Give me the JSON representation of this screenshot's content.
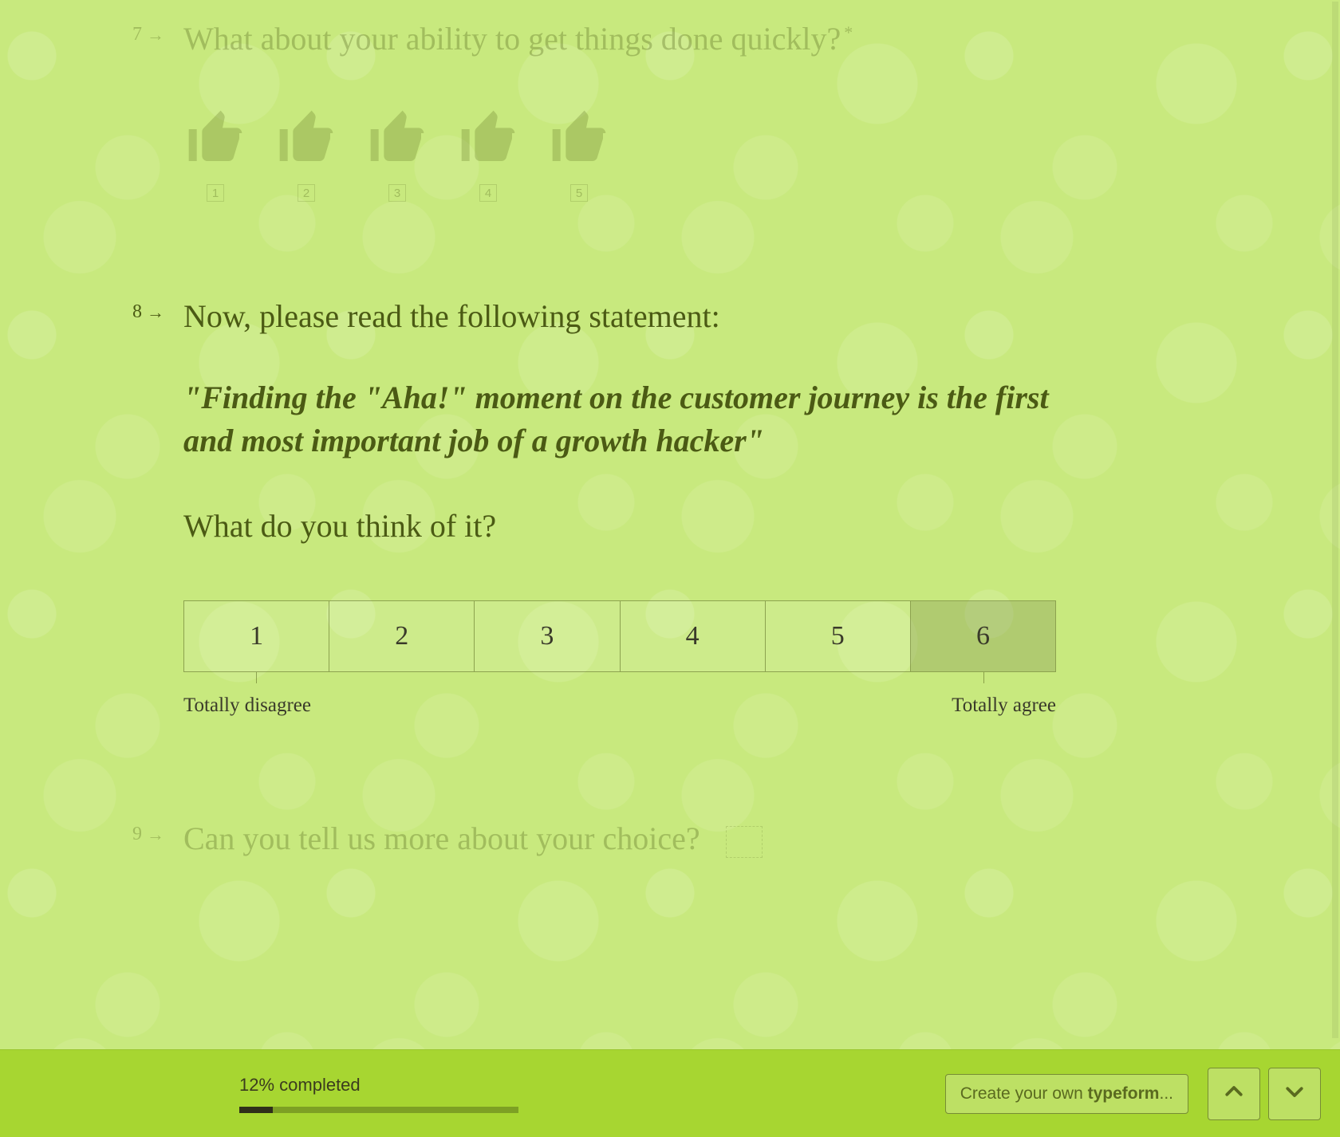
{
  "questions": {
    "q7": {
      "number": "7",
      "text": "What about your ability to get things done quickly?",
      "required_marker": "*",
      "rating": {
        "count": 5,
        "labels": [
          "1",
          "2",
          "3",
          "4",
          "5"
        ],
        "icon": "thumbs-up-icon"
      }
    },
    "q8": {
      "number": "8",
      "intro": "Now, please read the following statement:",
      "statement": "\"Finding the \"Aha!\" moment on the customer journey is the first and most important job of a growth hacker\"",
      "subquestion": "What do you think of it?",
      "scale": {
        "options": [
          "1",
          "2",
          "3",
          "4",
          "5",
          "6"
        ],
        "hover_index": 5,
        "min_label": "Totally disagree",
        "max_label": "Totally agree"
      }
    },
    "q9": {
      "number": "9",
      "text": "Can you tell us more about your choice?"
    }
  },
  "footer": {
    "progress_text": "12% completed",
    "progress_percent": 12,
    "brand_prefix": "Create your own ",
    "brand_bold": "typeform",
    "brand_suffix": "..."
  },
  "colors": {
    "background": "#c9ea7f",
    "text": "#4b5a14",
    "footer_bg": "#a7d631"
  }
}
